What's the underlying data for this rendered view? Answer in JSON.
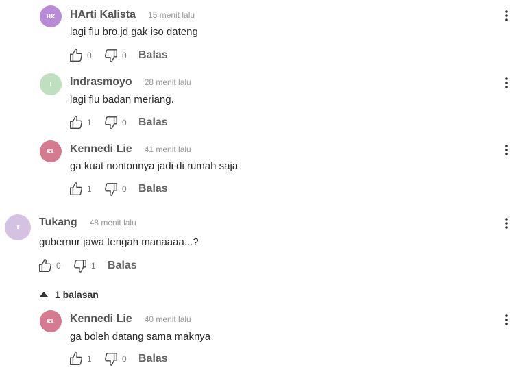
{
  "comments": [
    {
      "initials": "HK",
      "avatar_color": "#b98ad8",
      "name": "HArti Kalista",
      "time": "15 menit lalu",
      "text": "lagi flu bro,jd gak iso dateng",
      "likes": "0",
      "dislikes": "0",
      "reply_label": "Balas"
    },
    {
      "initials": "I",
      "avatar_color": "#bfe0bf",
      "name": "Indrasmoyo",
      "time": "28 menit lalu",
      "text": "lagi flu badan meriang.",
      "likes": "1",
      "dislikes": "0",
      "reply_label": "Balas"
    },
    {
      "initials": "KL",
      "avatar_color": "#d67b8f",
      "name": "Kennedi Lie",
      "time": "41 menit lalu",
      "text": "ga kuat nontonnya jadi di rumah saja",
      "likes": "1",
      "dislikes": "0",
      "reply_label": "Balas"
    },
    {
      "initials": "T",
      "avatar_color": "#d5c2e2",
      "name": "Tukang",
      "time": "48 menit lalu",
      "text": "gubernur jawa tengah manaaaa...?",
      "likes": "0",
      "dislikes": "1",
      "reply_label": "Balas"
    },
    {
      "initials": "KL",
      "avatar_color": "#d67b8f",
      "name": "Kennedi Lie",
      "time": "40 menit lalu",
      "text": "ga boleh datang sama maknya",
      "likes": "1",
      "dislikes": "0",
      "reply_label": "Balas"
    }
  ],
  "replies_toggle": {
    "label": "1 balasan"
  },
  "icons": {
    "like": "thumbs-up-icon",
    "dislike": "thumbs-down-icon",
    "more": "more-vertical-icon",
    "toggle": "caret-up-icon"
  }
}
